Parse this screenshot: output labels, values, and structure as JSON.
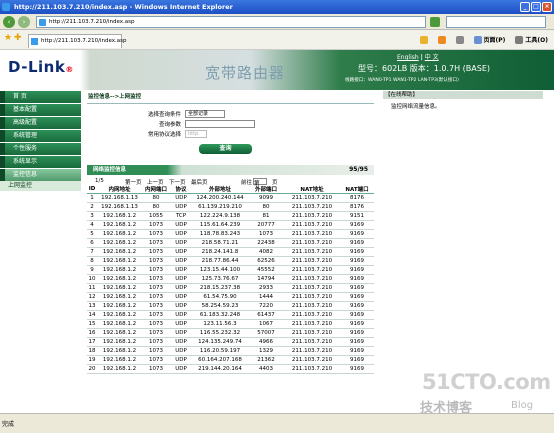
{
  "window": {
    "title": "http://211.103.7.210/index.asp - Windows Internet Explorer",
    "address": "http://211.103.7.210/index.asp",
    "search_placeholder": "",
    "tab_title": "http://211.103.7.210/index.asp",
    "commands": [
      "页面(P)",
      "工具(O)"
    ],
    "status": "完成"
  },
  "header": {
    "brand": "D-Link",
    "product": "宽带路由器",
    "lang_en": "English",
    "lang_sep": "|",
    "lang_cn": "中 文",
    "model": "型号：602LB 版本：1.0.7H (BASE)",
    "interfaces": "线路接口：WAN0-TP1 WAN1-TP2 LAN-TP3(默认接口)"
  },
  "sidebar": {
    "items": [
      {
        "label": "首  页"
      },
      {
        "label": "基本配置"
      },
      {
        "label": "高级配置"
      },
      {
        "label": "系统管理"
      },
      {
        "label": "个性服务"
      },
      {
        "label": "系统显示"
      },
      {
        "label": "监控信息"
      }
    ],
    "sub_label": "上网监控"
  },
  "main": {
    "breadcrumb": "监控信息-->上网监控",
    "form": {
      "cond_label": "选择查询条件",
      "cond_value": "全部记录",
      "param_label": "查询参数",
      "proto_label": "常用协议选择",
      "proto_value": "http",
      "query_button": "查询"
    },
    "table_title": "网络监控信息",
    "count": "95/95",
    "pager": {
      "page": "1/5",
      "first": "第一页",
      "prev": "上一页",
      "next": "下一页",
      "last": "最后页",
      "goto": "前往",
      "goto_value": "第",
      "page_suffix": "页"
    },
    "columns": [
      "ID",
      "内网地址",
      "内网端口",
      "协议",
      "外部地址",
      "外部端口",
      "NAT地址",
      "NAT端口"
    ],
    "rows": [
      [
        "1",
        "192.168.1.13",
        "80",
        "UDP",
        "124.200.240.144",
        "9099",
        "211.103.7.210",
        "8176"
      ],
      [
        "2",
        "192.168.1.13",
        "80",
        "UDP",
        "61.139.219.210",
        "80",
        "211.103.7.210",
        "8176"
      ],
      [
        "3",
        "192.168.1.2",
        "1055",
        "TCP",
        "122.224.9.138",
        "81",
        "211.103.7.210",
        "9151"
      ],
      [
        "4",
        "192.168.1.2",
        "1073",
        "UDP",
        "115.61.64.239",
        "20777",
        "211.103.7.210",
        "9169"
      ],
      [
        "5",
        "192.168.1.2",
        "1073",
        "UDP",
        "118.78.83.243",
        "1073",
        "211.103.7.210",
        "9169"
      ],
      [
        "6",
        "192.168.1.2",
        "1073",
        "UDP",
        "218.58.71.21",
        "22438",
        "211.103.7.210",
        "9169"
      ],
      [
        "7",
        "192.168.1.2",
        "1073",
        "UDP",
        "218.24.141.8",
        "4082",
        "211.103.7.210",
        "9169"
      ],
      [
        "8",
        "192.168.1.2",
        "1073",
        "UDP",
        "218.77.86.44",
        "62526",
        "211.103.7.210",
        "9169"
      ],
      [
        "9",
        "192.168.1.2",
        "1073",
        "UDP",
        "123.15.44.100",
        "45552",
        "211.103.7.210",
        "9169"
      ],
      [
        "10",
        "192.168.1.2",
        "1073",
        "UDP",
        "125.73.76.67",
        "14794",
        "211.103.7.210",
        "9169"
      ],
      [
        "11",
        "192.168.1.2",
        "1073",
        "UDP",
        "218.15.237.38",
        "2933",
        "211.103.7.210",
        "9169"
      ],
      [
        "12",
        "192.168.1.2",
        "1073",
        "UDP",
        "61.54.75.90",
        "1444",
        "211.103.7.210",
        "9169"
      ],
      [
        "13",
        "192.168.1.2",
        "1073",
        "UDP",
        "58.254.59.23",
        "7220",
        "211.103.7.210",
        "9169"
      ],
      [
        "14",
        "192.168.1.2",
        "1073",
        "UDP",
        "61.183.32.248",
        "61437",
        "211.103.7.210",
        "9169"
      ],
      [
        "15",
        "192.168.1.2",
        "1073",
        "UDP",
        "123.11.56.3",
        "1067",
        "211.103.7.210",
        "9169"
      ],
      [
        "16",
        "192.168.1.2",
        "1073",
        "UDP",
        "116.55.232.32",
        "57007",
        "211.103.7.210",
        "9169"
      ],
      [
        "17",
        "192.168.1.2",
        "1073",
        "UDP",
        "124.135.249.74",
        "4966",
        "211.103.7.210",
        "9169"
      ],
      [
        "18",
        "192.168.1.2",
        "1073",
        "UDP",
        "116.20.59.197",
        "1329",
        "211.103.7.210",
        "9169"
      ],
      [
        "19",
        "192.168.1.2",
        "1073",
        "UDP",
        "60.164.207.168",
        "21362",
        "211.103.7.210",
        "9169"
      ],
      [
        "20",
        "192.168.1.2",
        "1073",
        "UDP",
        "219.144.20.164",
        "4403",
        "211.103.7.210",
        "9169"
      ]
    ]
  },
  "help": {
    "title": "【在线帮助】",
    "text": "监控网络流量信息。"
  },
  "watermark": {
    "site": "51CTO.com",
    "blog_cn": "技术博客",
    "blog_en": "Blog"
  }
}
